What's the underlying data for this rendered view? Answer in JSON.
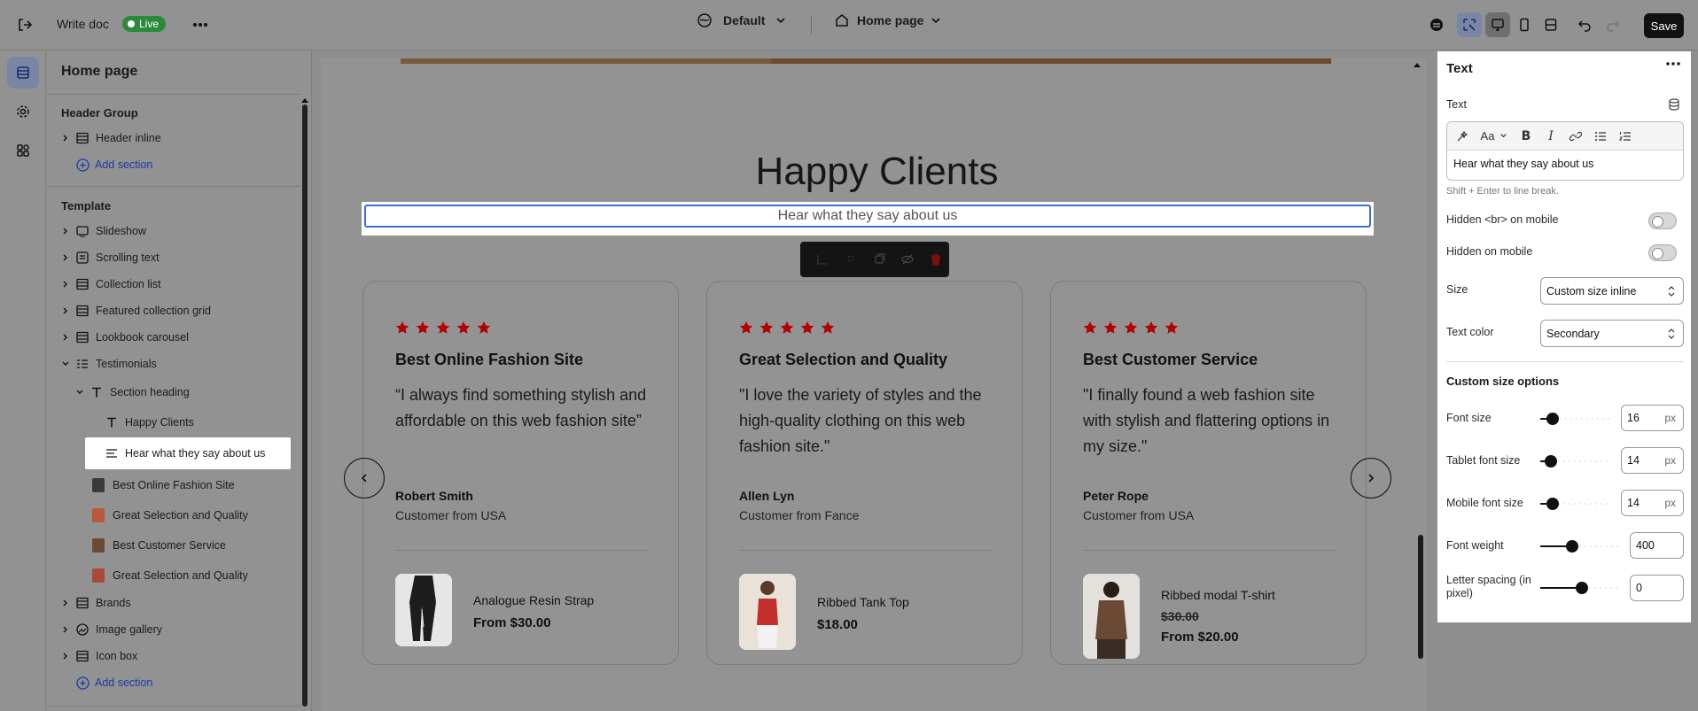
{
  "topbar": {
    "doc_title": "Write doc",
    "live_label": "Live",
    "theme_select": "Default",
    "page_select": "Home page",
    "save_label": "Save"
  },
  "sidebar": {
    "title": "Home page",
    "header_group": {
      "label": "Header Group",
      "items": [
        {
          "label": "Header inline"
        }
      ],
      "add_label": "Add section"
    },
    "template": {
      "label": "Template",
      "items": [
        {
          "label": "Slideshow"
        },
        {
          "label": "Scrolling text"
        },
        {
          "label": "Collection list"
        },
        {
          "label": "Featured collection grid"
        },
        {
          "label": "Lookbook carousel"
        },
        {
          "label": "Testimonials"
        },
        {
          "label": "Section heading"
        },
        {
          "label": "Happy Clients"
        },
        {
          "label": "Hear what they say about us"
        },
        {
          "label": "Best Online Fashion Site"
        },
        {
          "label": "Great Selection and Quality"
        },
        {
          "label": "Best Customer Service"
        },
        {
          "label": "Great Selection and Quality"
        },
        {
          "label": "Brands"
        },
        {
          "label": "Image gallery"
        },
        {
          "label": "Icon box"
        }
      ],
      "add_label": "Add section"
    }
  },
  "canvas": {
    "heading": "Happy Clients",
    "subheading": "Hear what they say about us",
    "star_color": "#c00000",
    "cards": [
      {
        "title": "Best Online Fashion Site",
        "quote": "“I always find something stylish and affordable on this web fashion site”",
        "author": "Robert Smith",
        "origin": "Customer from USA",
        "product": {
          "name": "Analogue Resin Strap",
          "price": "From $30.00"
        }
      },
      {
        "title": "Great Selection and Quality",
        "quote": "\"I love the variety of styles and the high-quality clothing on this web fashion site.\"",
        "author": "Allen Lyn",
        "origin": "Customer from Fance",
        "product": {
          "name": "Ribbed Tank Top",
          "price": "$18.00"
        }
      },
      {
        "title": "Best Customer Service",
        "quote": "\"I finally found a web fashion site with stylish and flattering options in my size.\"",
        "author": "Peter Rope",
        "origin": "Customer from USA",
        "product": {
          "name": "Ribbed modal T-shirt",
          "old_price": "$30.00",
          "price": "From $20.00"
        }
      }
    ]
  },
  "panel": {
    "title": "Text",
    "text_label": "Text",
    "text_value": "Hear what they say about us",
    "hint": "Shift + Enter to line break.",
    "hidden_br_label": "Hidden <br> on mobile",
    "hidden_mobile_label": "Hidden on mobile",
    "size_label": "Size",
    "size_value": "Custom size inline",
    "color_label": "Text color",
    "color_value": "Secondary",
    "custom_title": "Custom size options",
    "font_size_label": "Font size",
    "font_size_value": "16",
    "tablet_label": "Tablet font size",
    "tablet_value": "14",
    "mobile_label": "Mobile font size",
    "mobile_value": "14",
    "unit": "px",
    "weight_label": "Font weight",
    "weight_value": "400",
    "spacing_label": "Letter spacing (in pixel)",
    "spacing_value": "0"
  }
}
